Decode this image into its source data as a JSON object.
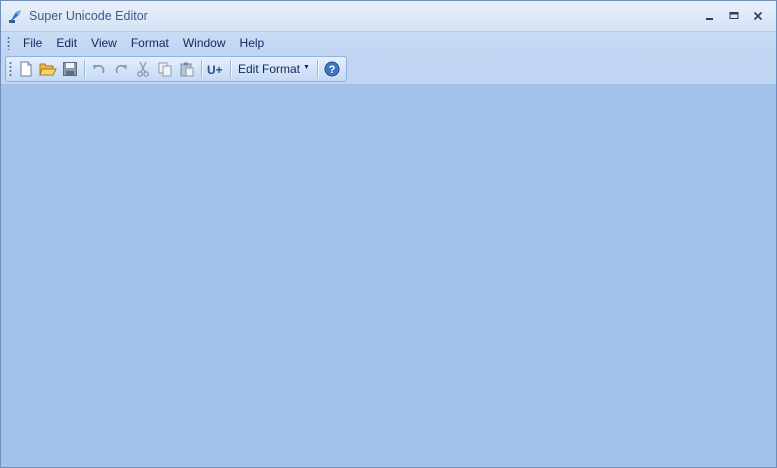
{
  "window": {
    "title": "Super Unicode Editor",
    "controls": [
      "minimize",
      "maximize",
      "close"
    ]
  },
  "menubar": {
    "items": [
      {
        "label": "File"
      },
      {
        "label": "Edit"
      },
      {
        "label": "View"
      },
      {
        "label": "Format"
      },
      {
        "label": "Window"
      },
      {
        "label": "Help"
      }
    ]
  },
  "toolbar": {
    "buttons": [
      {
        "icon": "new-document-icon"
      },
      {
        "icon": "open-folder-icon"
      },
      {
        "icon": "save-icon"
      },
      {
        "icon": "undo-icon"
      },
      {
        "icon": "redo-icon"
      },
      {
        "icon": "cut-icon"
      },
      {
        "icon": "copy-icon"
      },
      {
        "icon": "paste-icon"
      },
      {
        "icon": "insert-unicode-icon",
        "label": "U+"
      },
      {
        "icon": "help-icon",
        "label": "?"
      }
    ],
    "edit_format_label": "Edit Format"
  },
  "colors": {
    "workspace": "#a3c2e9",
    "menubar": "#bfd5f1",
    "text": "#15285a",
    "title_text": "#3e5b86"
  }
}
